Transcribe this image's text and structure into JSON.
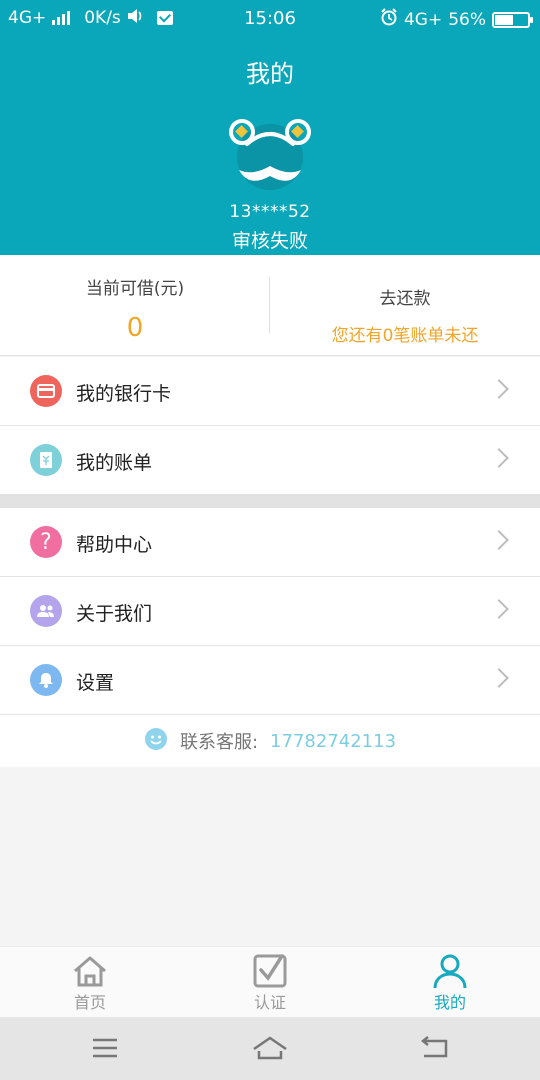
{
  "status_bar": {
    "network_left": "4G+",
    "speed": "0K/s",
    "time": "15:06",
    "network_right": "4G+",
    "battery": "56%",
    "battery_level": 0.56
  },
  "header": {
    "title": "我的",
    "account": "13****52",
    "status": "审核失败"
  },
  "loan": {
    "current_label": "当前可借(元)",
    "current_value": "0",
    "repay_label": "去还款",
    "repay_note": "您还有0笔账单未还"
  },
  "menu_group_1": [
    {
      "label": "我的银行卡",
      "icon": "bank-card-icon",
      "color": "#f0645e"
    },
    {
      "label": "我的账单",
      "icon": "bill-icon",
      "color": "#7ed0d9"
    }
  ],
  "menu_group_2": [
    {
      "label": "帮助中心",
      "icon": "help-icon",
      "color": "#f06ea0"
    },
    {
      "label": "关于我们",
      "icon": "about-us-icon",
      "color": "#b3a4ec"
    },
    {
      "label": "设置",
      "icon": "settings-bell-icon",
      "color": "#7eb8f0"
    }
  ],
  "service": {
    "label": "联系客服:",
    "phone": "17782742113"
  },
  "tabs": [
    {
      "label": "首页",
      "icon": "home-icon",
      "active": false
    },
    {
      "label": "认证",
      "icon": "verify-icon",
      "active": false
    },
    {
      "label": "我的",
      "icon": "profile-icon",
      "active": true
    }
  ],
  "colors": {
    "primary": "#09a7b9",
    "accent_orange": "#f0a628",
    "tab_active": "#17a9c0"
  }
}
